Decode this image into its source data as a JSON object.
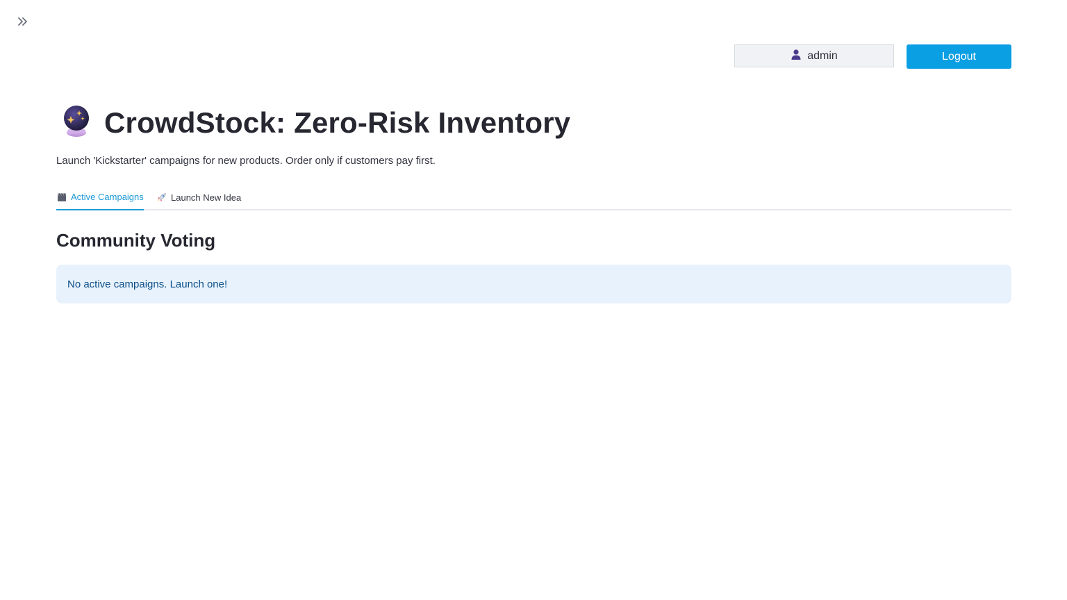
{
  "header": {
    "username": "admin",
    "logout_label": "Logout"
  },
  "main": {
    "title": "CrowdStock: Zero-Risk Inventory",
    "subtitle": "Launch 'Kickstarter' campaigns for new products. Order only if customers pay first.",
    "tabs": [
      {
        "label": "Active Campaigns",
        "icon": "clapper-board-icon",
        "active": true
      },
      {
        "label": "Launch New Idea",
        "icon": "rocket-icon",
        "active": false
      }
    ],
    "section_heading": "Community Voting",
    "info_message": "No active campaigns. Launch one!"
  },
  "colors": {
    "accent": "#0a9ee3",
    "tab_active": "#1c9ad6",
    "info_background": "#e8f2fc",
    "info_text": "#0b4f8a"
  }
}
